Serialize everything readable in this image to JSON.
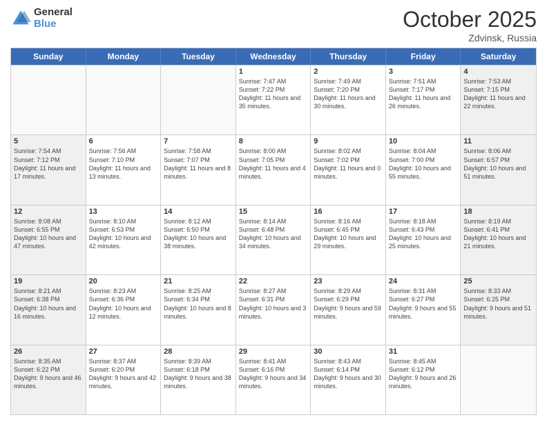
{
  "header": {
    "logo_general": "General",
    "logo_blue": "Blue",
    "month_title": "October 2025",
    "location": "Zdvinsk, Russia"
  },
  "days_of_week": [
    "Sunday",
    "Monday",
    "Tuesday",
    "Wednesday",
    "Thursday",
    "Friday",
    "Saturday"
  ],
  "rows": [
    [
      {
        "day": "",
        "info": "",
        "shaded": false,
        "empty": true
      },
      {
        "day": "",
        "info": "",
        "shaded": false,
        "empty": true
      },
      {
        "day": "",
        "info": "",
        "shaded": false,
        "empty": true
      },
      {
        "day": "1",
        "info": "Sunrise: 7:47 AM\nSunset: 7:22 PM\nDaylight: 11 hours and 35 minutes.",
        "shaded": false,
        "empty": false
      },
      {
        "day": "2",
        "info": "Sunrise: 7:49 AM\nSunset: 7:20 PM\nDaylight: 11 hours and 30 minutes.",
        "shaded": false,
        "empty": false
      },
      {
        "day": "3",
        "info": "Sunrise: 7:51 AM\nSunset: 7:17 PM\nDaylight: 11 hours and 26 minutes.",
        "shaded": false,
        "empty": false
      },
      {
        "day": "4",
        "info": "Sunrise: 7:53 AM\nSunset: 7:15 PM\nDaylight: 11 hours and 22 minutes.",
        "shaded": true,
        "empty": false
      }
    ],
    [
      {
        "day": "5",
        "info": "Sunrise: 7:54 AM\nSunset: 7:12 PM\nDaylight: 11 hours and 17 minutes.",
        "shaded": true,
        "empty": false
      },
      {
        "day": "6",
        "info": "Sunrise: 7:56 AM\nSunset: 7:10 PM\nDaylight: 11 hours and 13 minutes.",
        "shaded": false,
        "empty": false
      },
      {
        "day": "7",
        "info": "Sunrise: 7:58 AM\nSunset: 7:07 PM\nDaylight: 11 hours and 8 minutes.",
        "shaded": false,
        "empty": false
      },
      {
        "day": "8",
        "info": "Sunrise: 8:00 AM\nSunset: 7:05 PM\nDaylight: 11 hours and 4 minutes.",
        "shaded": false,
        "empty": false
      },
      {
        "day": "9",
        "info": "Sunrise: 8:02 AM\nSunset: 7:02 PM\nDaylight: 11 hours and 0 minutes.",
        "shaded": false,
        "empty": false
      },
      {
        "day": "10",
        "info": "Sunrise: 8:04 AM\nSunset: 7:00 PM\nDaylight: 10 hours and 55 minutes.",
        "shaded": false,
        "empty": false
      },
      {
        "day": "11",
        "info": "Sunrise: 8:06 AM\nSunset: 6:57 PM\nDaylight: 10 hours and 51 minutes.",
        "shaded": true,
        "empty": false
      }
    ],
    [
      {
        "day": "12",
        "info": "Sunrise: 8:08 AM\nSunset: 6:55 PM\nDaylight: 10 hours and 47 minutes.",
        "shaded": true,
        "empty": false
      },
      {
        "day": "13",
        "info": "Sunrise: 8:10 AM\nSunset: 6:53 PM\nDaylight: 10 hours and 42 minutes.",
        "shaded": false,
        "empty": false
      },
      {
        "day": "14",
        "info": "Sunrise: 8:12 AM\nSunset: 6:50 PM\nDaylight: 10 hours and 38 minutes.",
        "shaded": false,
        "empty": false
      },
      {
        "day": "15",
        "info": "Sunrise: 8:14 AM\nSunset: 6:48 PM\nDaylight: 10 hours and 34 minutes.",
        "shaded": false,
        "empty": false
      },
      {
        "day": "16",
        "info": "Sunrise: 8:16 AM\nSunset: 6:45 PM\nDaylight: 10 hours and 29 minutes.",
        "shaded": false,
        "empty": false
      },
      {
        "day": "17",
        "info": "Sunrise: 8:18 AM\nSunset: 6:43 PM\nDaylight: 10 hours and 25 minutes.",
        "shaded": false,
        "empty": false
      },
      {
        "day": "18",
        "info": "Sunrise: 8:19 AM\nSunset: 6:41 PM\nDaylight: 10 hours and 21 minutes.",
        "shaded": true,
        "empty": false
      }
    ],
    [
      {
        "day": "19",
        "info": "Sunrise: 8:21 AM\nSunset: 6:38 PM\nDaylight: 10 hours and 16 minutes.",
        "shaded": true,
        "empty": false
      },
      {
        "day": "20",
        "info": "Sunrise: 8:23 AM\nSunset: 6:36 PM\nDaylight: 10 hours and 12 minutes.",
        "shaded": false,
        "empty": false
      },
      {
        "day": "21",
        "info": "Sunrise: 8:25 AM\nSunset: 6:34 PM\nDaylight: 10 hours and 8 minutes.",
        "shaded": false,
        "empty": false
      },
      {
        "day": "22",
        "info": "Sunrise: 8:27 AM\nSunset: 6:31 PM\nDaylight: 10 hours and 3 minutes.",
        "shaded": false,
        "empty": false
      },
      {
        "day": "23",
        "info": "Sunrise: 8:29 AM\nSunset: 6:29 PM\nDaylight: 9 hours and 59 minutes.",
        "shaded": false,
        "empty": false
      },
      {
        "day": "24",
        "info": "Sunrise: 8:31 AM\nSunset: 6:27 PM\nDaylight: 9 hours and 55 minutes.",
        "shaded": false,
        "empty": false
      },
      {
        "day": "25",
        "info": "Sunrise: 8:33 AM\nSunset: 6:25 PM\nDaylight: 9 hours and 51 minutes.",
        "shaded": true,
        "empty": false
      }
    ],
    [
      {
        "day": "26",
        "info": "Sunrise: 8:35 AM\nSunset: 6:22 PM\nDaylight: 9 hours and 46 minutes.",
        "shaded": true,
        "empty": false
      },
      {
        "day": "27",
        "info": "Sunrise: 8:37 AM\nSunset: 6:20 PM\nDaylight: 9 hours and 42 minutes.",
        "shaded": false,
        "empty": false
      },
      {
        "day": "28",
        "info": "Sunrise: 8:39 AM\nSunset: 6:18 PM\nDaylight: 9 hours and 38 minutes.",
        "shaded": false,
        "empty": false
      },
      {
        "day": "29",
        "info": "Sunrise: 8:41 AM\nSunset: 6:16 PM\nDaylight: 9 hours and 34 minutes.",
        "shaded": false,
        "empty": false
      },
      {
        "day": "30",
        "info": "Sunrise: 8:43 AM\nSunset: 6:14 PM\nDaylight: 9 hours and 30 minutes.",
        "shaded": false,
        "empty": false
      },
      {
        "day": "31",
        "info": "Sunrise: 8:45 AM\nSunset: 6:12 PM\nDaylight: 9 hours and 26 minutes.",
        "shaded": false,
        "empty": false
      },
      {
        "day": "",
        "info": "",
        "shaded": true,
        "empty": true
      }
    ]
  ]
}
